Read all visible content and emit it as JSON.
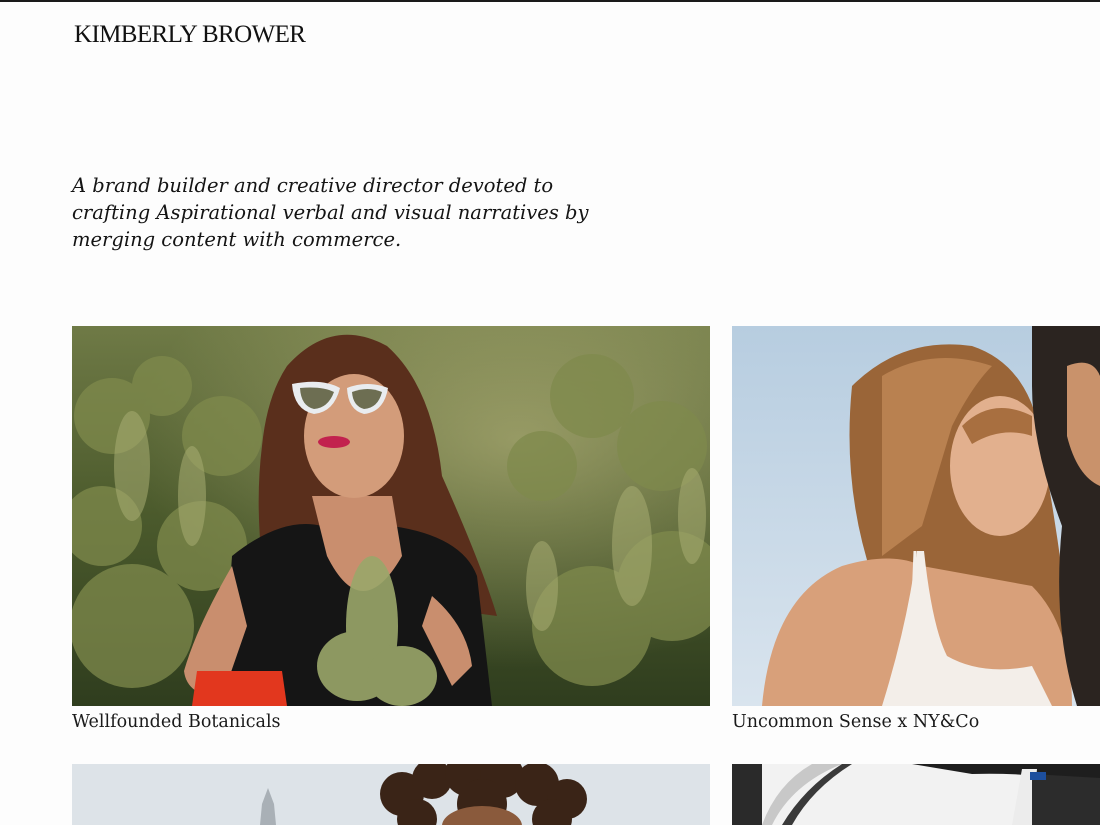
{
  "site": {
    "title": "KIMBERLY BROWER"
  },
  "intro": {
    "tagline": "A brand builder and creative director devoted to crafting Aspirational verbal and visual narratives by merging content with commerce."
  },
  "projects": [
    {
      "caption": "Wellfounded Botanicals",
      "image": "woman-sunglasses-cannabis-field-photo"
    },
    {
      "caption": "Uncommon Sense x NY&Co",
      "image": "women-beach-sky-photo"
    },
    {
      "caption": "",
      "image": "woman-curly-hair-city-photo"
    },
    {
      "caption": "",
      "image": "car-interior-photo"
    }
  ],
  "colors": {
    "background": "#fdfdfd",
    "text": "#111111"
  }
}
